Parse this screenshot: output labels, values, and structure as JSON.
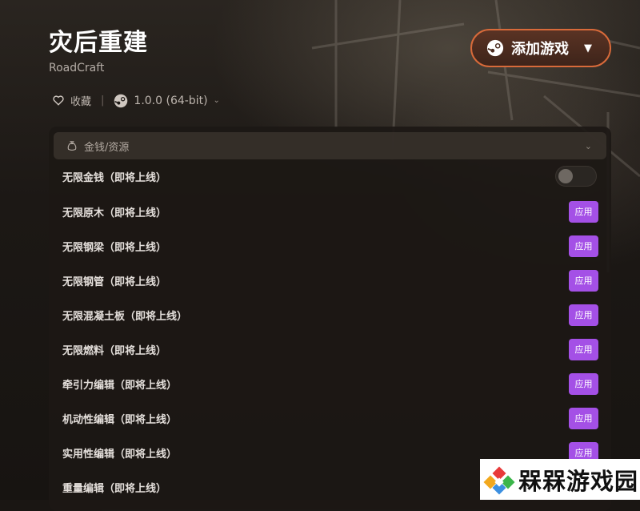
{
  "header": {
    "title": "灾后重建",
    "subtitle": "RoadCraft",
    "favorite_label": "收藏",
    "separator": "|",
    "version_label": "1.0.0 (64-bit)"
  },
  "add_game_button": {
    "label": "添加游戏"
  },
  "panel": {
    "category_label": "金钱/资源",
    "rows": [
      {
        "label": "无限金钱（即将上线）",
        "control": "toggle",
        "toggle_state": "off"
      },
      {
        "label": "无限原木（即将上线）",
        "control": "button",
        "button_label": "应用"
      },
      {
        "label": "无限钢梁（即将上线）",
        "control": "button",
        "button_label": "应用"
      },
      {
        "label": "无限钢管（即将上线）",
        "control": "button",
        "button_label": "应用"
      },
      {
        "label": "无限混凝土板（即将上线）",
        "control": "button",
        "button_label": "应用"
      },
      {
        "label": "无限燃料（即将上线）",
        "control": "button",
        "button_label": "应用"
      },
      {
        "label": "牵引力编辑（即将上线）",
        "control": "button",
        "button_label": "应用"
      },
      {
        "label": "机动性编辑（即将上线）",
        "control": "button",
        "button_label": "应用"
      },
      {
        "label": "实用性编辑（即将上线）",
        "control": "button",
        "button_label": "应用"
      },
      {
        "label": "重量编辑（即将上线）",
        "control": "none"
      }
    ]
  },
  "watermark": {
    "text": "槑槑游戏园"
  },
  "colors": {
    "accent_orange": "#d86a3a",
    "apply_purple": "#a450e6",
    "background": "#1a1613"
  }
}
